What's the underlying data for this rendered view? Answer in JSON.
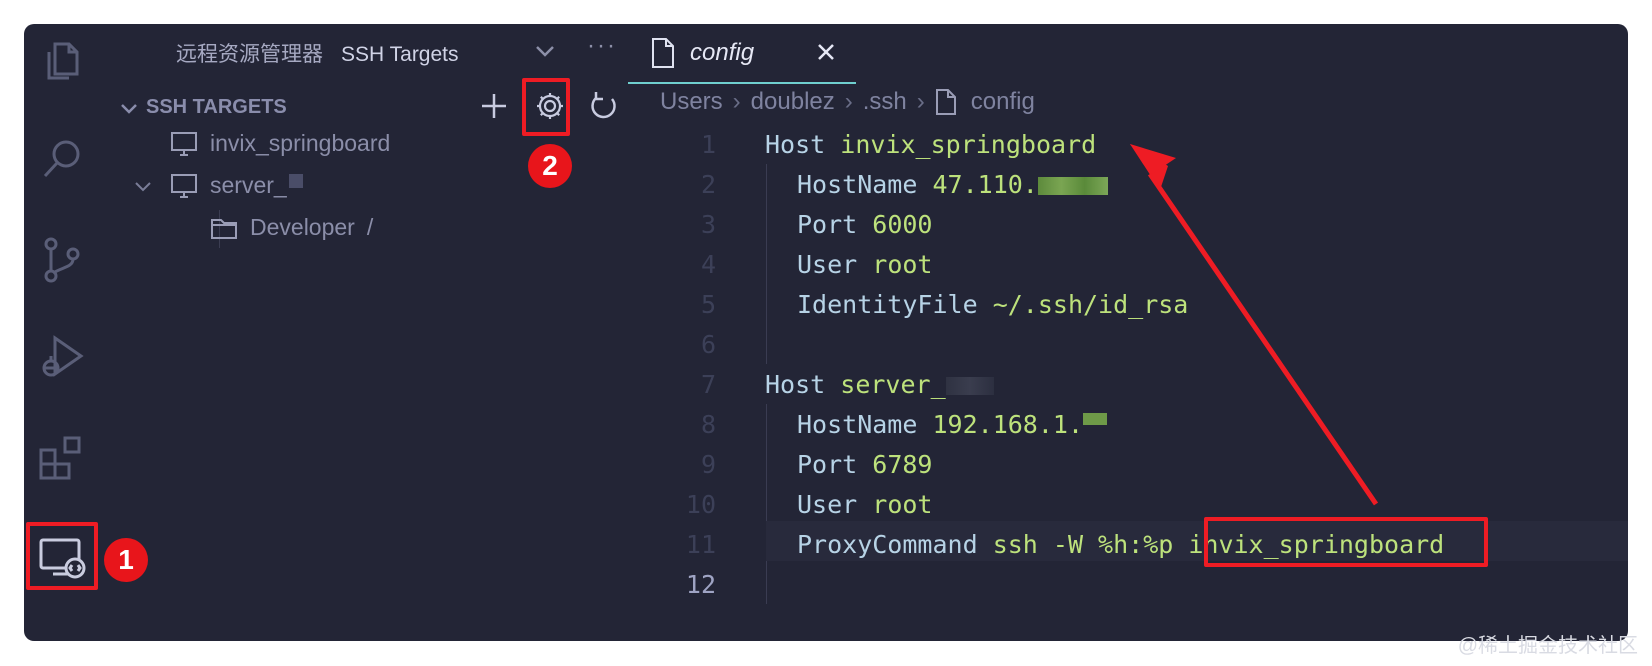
{
  "sidebar": {
    "title": "远程资源管理器",
    "view_select": "SSH Targets",
    "section_title": "SSH TARGETS",
    "items": [
      {
        "label": "invix_springboard"
      },
      {
        "label": "server_"
      },
      {
        "label": "Developer"
      }
    ],
    "developer_path": "/",
    "more_label": "···"
  },
  "editor": {
    "tab_label": "config",
    "breadcrumbs": [
      "Users",
      "doublez",
      ".ssh",
      "config"
    ],
    "lines": [
      {
        "n": "1",
        "k": "Host",
        "v": "invix_springboard"
      },
      {
        "n": "2",
        "k": "HostName",
        "v": "47.110."
      },
      {
        "n": "3",
        "k": "Port",
        "v": "6000"
      },
      {
        "n": "4",
        "k": "User",
        "v": "root"
      },
      {
        "n": "5",
        "k": "IdentityFile",
        "v": "~/.ssh/id_rsa"
      },
      {
        "n": "6",
        "k": "",
        "v": ""
      },
      {
        "n": "7",
        "k": "Host",
        "v": "server_"
      },
      {
        "n": "8",
        "k": "HostName",
        "v": "192.168.1."
      },
      {
        "n": "9",
        "k": "Port",
        "v": "6789"
      },
      {
        "n": "10",
        "k": "User",
        "v": "root"
      },
      {
        "n": "11",
        "k": "ProxyCommand",
        "v": "ssh -W %h:%p invix_springboard"
      },
      {
        "n": "12",
        "k": "",
        "v": ""
      }
    ]
  },
  "annotations": {
    "badge1": "1",
    "badge2": "2",
    "highlight_color": "#ee1c24"
  },
  "watermark": "@稀土掘金技术社区"
}
